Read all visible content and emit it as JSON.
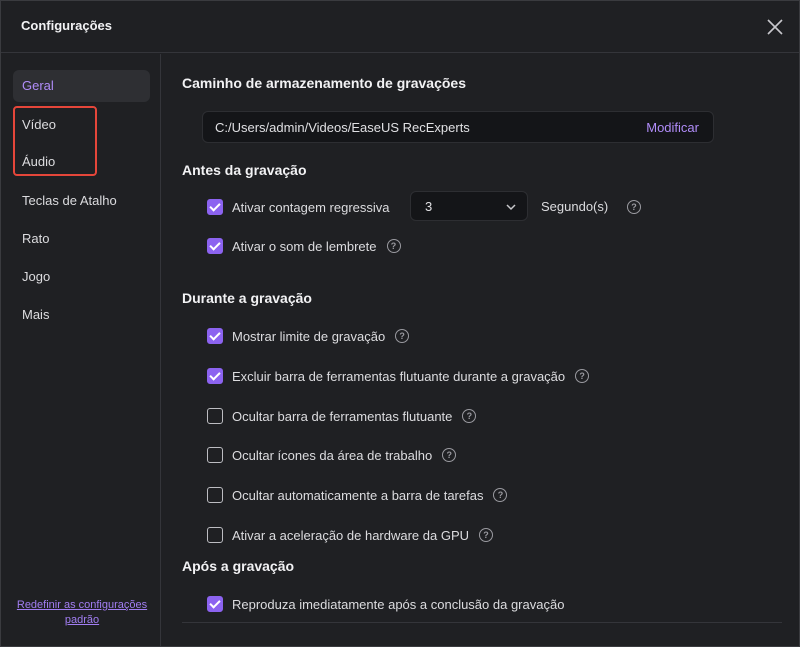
{
  "window": {
    "title": "Configurações"
  },
  "sidebar": {
    "items": [
      {
        "label": "Geral",
        "active": true
      },
      {
        "label": "Vídeo"
      },
      {
        "label": "Áudio"
      },
      {
        "label": "Teclas de Atalho"
      },
      {
        "label": "Rato"
      },
      {
        "label": "Jogo"
      },
      {
        "label": "Mais"
      }
    ],
    "reset_label": "Redefinir as configurações padrão"
  },
  "storage": {
    "title": "Caminho de armazenamento de gravações",
    "path": "C:/Users/admin/Videos/EaseUS RecExperts",
    "modify_label": "Modificar"
  },
  "before": {
    "title": "Antes da gravação",
    "countdown_label": "Ativar contagem regressiva",
    "countdown_checked": true,
    "countdown_value": "3",
    "countdown_unit": "Segundo(s)",
    "reminder_label": "Ativar o som de lembrete",
    "reminder_checked": true
  },
  "during": {
    "title": "Durante a gravação",
    "options": [
      {
        "label": "Mostrar limite de gravação",
        "checked": true
      },
      {
        "label": "Excluir barra de ferramentas flutuante durante a gravação",
        "checked": true
      },
      {
        "label": "Ocultar barra de ferramentas flutuante",
        "checked": false
      },
      {
        "label": "Ocultar ícones da área de trabalho",
        "checked": false
      },
      {
        "label": "Ocultar automaticamente a barra de tarefas",
        "checked": false
      },
      {
        "label": "Ativar a aceleração de hardware da GPU",
        "checked": false
      }
    ]
  },
  "after": {
    "title": "Após a gravação",
    "play_label": "Reproduza imediatamente após a conclusão da gravação",
    "play_checked": true
  },
  "colors": {
    "accent": "#8c63f0",
    "highlight": "#e5463a"
  },
  "icons": {
    "close": "close-icon",
    "help": "help-circle-icon",
    "dropdown": "chevron-down-icon"
  }
}
